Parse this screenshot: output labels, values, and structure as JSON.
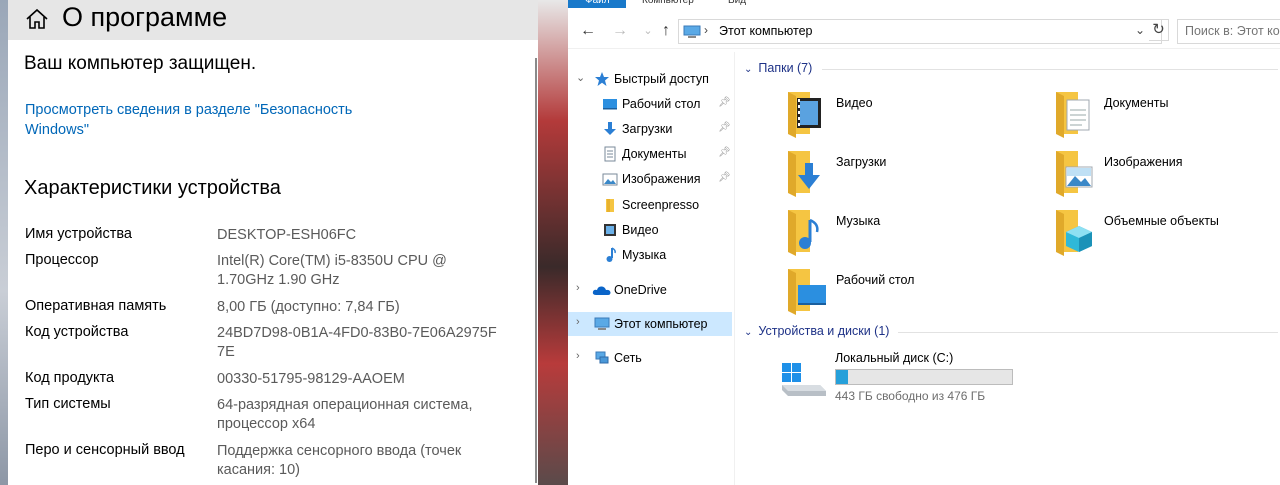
{
  "settings": {
    "title": "О программе",
    "protection_text": "Ваш компьютер защищен.",
    "security_link": "Просмотреть сведения в разделе \"Безопасность Windows\"",
    "device_heading": "Характеристики устройства",
    "specs": [
      {
        "label": "Имя устройства",
        "value": "DESKTOP-ESH06FC"
      },
      {
        "label": "Процессор",
        "value": "Intel(R) Core(TM) i5-8350U CPU @ 1.70GHz 1.90 GHz"
      },
      {
        "label": "Оперативная память",
        "value": "8,00 ГБ (доступно: 7,84 ГБ)"
      },
      {
        "label": "Код устройства",
        "value": "24BD7D98-0B1A-4FD0-83B0-7E06A2975F7E"
      },
      {
        "label": "Код продукта",
        "value": "00330-51795-98129-AAOEM"
      },
      {
        "label": "Тип системы",
        "value": "64-разрядная операционная система, процессор x64"
      },
      {
        "label": "Перо и сенсорный ввод",
        "value": "Поддержка сенсорного ввода (точек касания: 10)"
      }
    ]
  },
  "explorer": {
    "ribbon_tabs": [
      "Файл",
      "Компьютер",
      "Вид"
    ],
    "address": "Этот компьютер",
    "search_placeholder": "Поиск в: Этот компьютер",
    "nav": {
      "quick_access": "Быстрый доступ",
      "quick_items": [
        {
          "label": "Рабочий стол",
          "icon": "desktop-icon",
          "pinned": true
        },
        {
          "label": "Загрузки",
          "icon": "downloads-icon",
          "pinned": true
        },
        {
          "label": "Документы",
          "icon": "documents-icon",
          "pinned": true
        },
        {
          "label": "Изображения",
          "icon": "pictures-icon",
          "pinned": true
        },
        {
          "label": "Screenpresso",
          "icon": "folder-icon",
          "pinned": false
        },
        {
          "label": "Видео",
          "icon": "videos-icon",
          "pinned": false
        },
        {
          "label": "Музыка",
          "icon": "music-icon",
          "pinned": false
        }
      ],
      "onedrive": "OneDrive",
      "this_pc": "Этот компьютер",
      "network": "Сеть"
    },
    "folders_header": "Папки (7)",
    "folders": [
      "Видео",
      "Документы",
      "Загрузки",
      "Изображения",
      "Музыка",
      "Объемные объекты",
      "Рабочий стол"
    ],
    "devices_header": "Устройства и диски (1)",
    "drive": {
      "name": "Локальный диск (C:)",
      "free_text": "443 ГБ свободно из 476 ГБ",
      "used_fraction": 0.07
    },
    "accent_color": "#1979ca"
  }
}
